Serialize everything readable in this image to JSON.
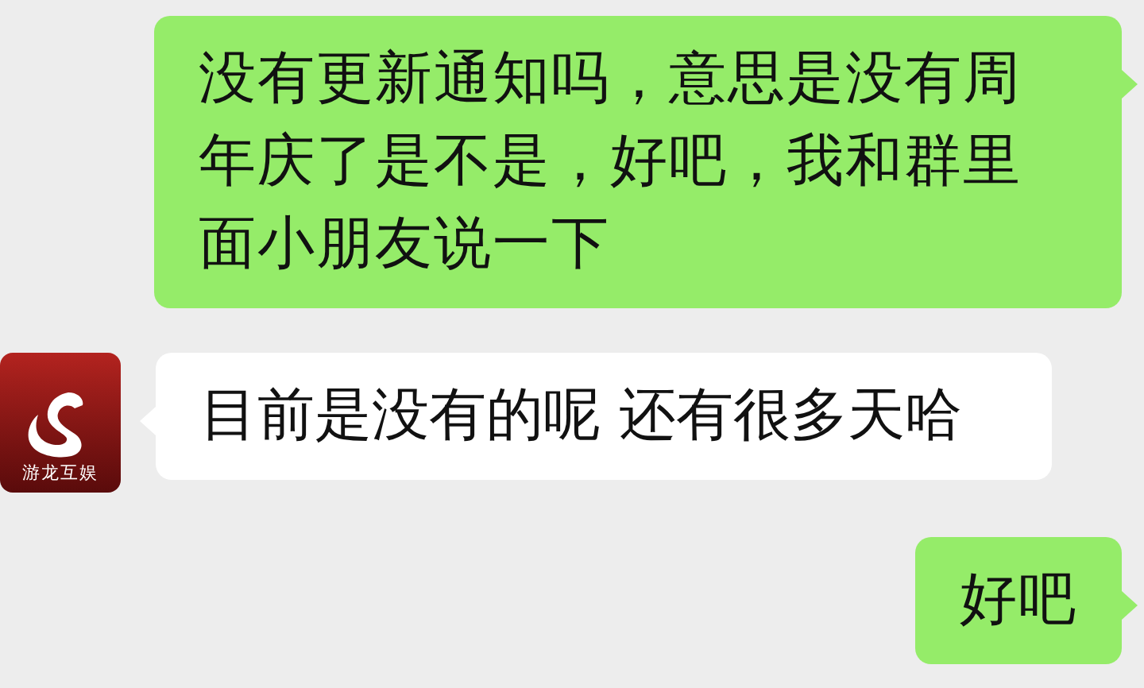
{
  "messages": [
    {
      "kind": "sent",
      "text": "没有更新通知吗，意思是没有周年庆了是不是，好吧，我和群里面小朋友说一下"
    },
    {
      "kind": "received",
      "avatar": {
        "logo_text": "游龙互娱"
      },
      "text": "目前是没有的呢 还有很多天哈"
    },
    {
      "kind": "sent",
      "text": "好吧"
    }
  ]
}
